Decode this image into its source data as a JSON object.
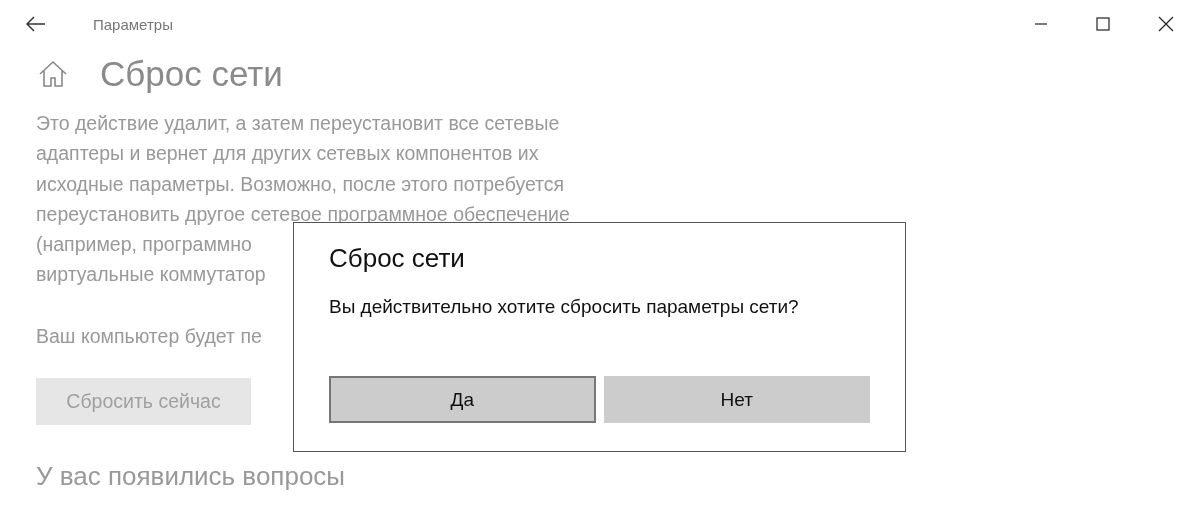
{
  "window": {
    "title": "Параметры",
    "controls": [
      {
        "kind": "minimize"
      },
      {
        "kind": "maximize"
      },
      {
        "kind": "close"
      }
    ]
  },
  "page": {
    "title": "Сброс сети",
    "description_lines": [
      "Это действие удалит, а затем переустановит все сетевые",
      "адаптеры и вернет для других сетевых компонентов их",
      "исходные параметры. Возможно, после этого потребуется",
      "переустановить другое сетевое программное обеспечение",
      "(например, программно",
      "виртуальные коммутатор"
    ],
    "note": "Ваш компьютер будет пе",
    "reset_button": {
      "label": "Сбросить сейчас",
      "disabled": true
    },
    "questions_heading": "У вас появились вопросы"
  },
  "dialog": {
    "title": "Сброс сети",
    "message": "Вы действительно хотите сбросить параметры сети?",
    "buttons": [
      {
        "label": "Да",
        "focused": true
      },
      {
        "label": "Нет",
        "focused": false
      }
    ]
  }
}
